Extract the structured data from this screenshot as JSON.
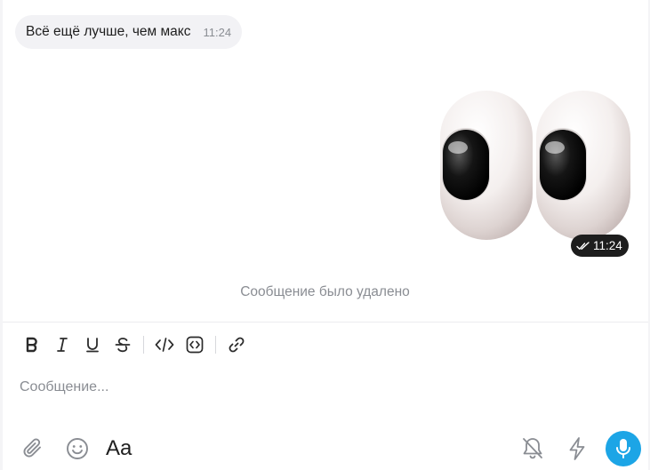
{
  "chat": {
    "incoming_message": {
      "text": "Всё ещё лучше, чем макс",
      "time": "11:24"
    },
    "sticker_message": {
      "sticker": "googly-eyes",
      "time": "11:24",
      "status": "read"
    },
    "deleted_notice": "Сообщение было удалено"
  },
  "composer": {
    "toolbar": [
      {
        "name": "bold",
        "icon": "bold-icon"
      },
      {
        "name": "italic",
        "icon": "italic-icon"
      },
      {
        "name": "underline",
        "icon": "underline-icon"
      },
      {
        "name": "strikethrough",
        "icon": "strikethrough-icon"
      },
      {
        "name": "code",
        "icon": "code-icon"
      },
      {
        "name": "code-block",
        "icon": "code-block-icon"
      },
      {
        "name": "link",
        "icon": "link-icon"
      }
    ],
    "placeholder": "Сообщение...",
    "value": "",
    "format_label": "Aa",
    "icons": {
      "attach": "paperclip-icon",
      "emoji": "smile-icon",
      "notifications": "bell-off-icon",
      "quick": "lightning-icon",
      "voice": "microphone-icon"
    }
  },
  "colors": {
    "accent": "#1ca5e6",
    "bubble": "#f2f2f5",
    "muted_text": "#8a8d93",
    "time_badge": "#1d1d1d"
  }
}
